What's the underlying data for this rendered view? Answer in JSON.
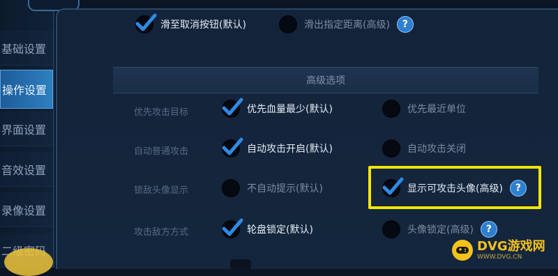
{
  "sidebar": {
    "items": [
      {
        "label": "基础设置",
        "active": false
      },
      {
        "label": "操作设置",
        "active": true
      },
      {
        "label": "界面设置",
        "active": false
      },
      {
        "label": "音效设置",
        "active": false
      },
      {
        "label": "录像设置",
        "active": false
      },
      {
        "label": "二级密码",
        "active": false
      }
    ]
  },
  "top_row": {
    "opt1": {
      "label": "滑至取消按钮(默认)",
      "checked": true
    },
    "opt2": {
      "label": "滑出指定距离(高级)",
      "checked": false,
      "help": "?"
    }
  },
  "advanced": {
    "header": "高级选项",
    "rows": [
      {
        "label": "优先攻击目标",
        "left": {
          "label": "优先血量最少(默认)",
          "checked": true
        },
        "right": {
          "label": "优先最近单位",
          "checked": false
        }
      },
      {
        "label": "自动普通攻击",
        "left": {
          "label": "自动攻击开启(默认)",
          "checked": true
        },
        "right": {
          "label": "自动攻击关闭",
          "checked": false
        }
      },
      {
        "label": "锁敌头像显示",
        "left": {
          "label": "不自动提示(默认)",
          "checked": false
        },
        "right": {
          "label": "显示可攻击头像(高级)",
          "checked": true,
          "help": "?"
        }
      },
      {
        "label": "攻击敌方方式",
        "left": {
          "label": "轮盘锁定(默认)",
          "checked": true
        },
        "right": {
          "label": "头像锁定(高级)",
          "checked": false,
          "help": "?"
        }
      }
    ]
  },
  "logo": {
    "main": "DVG游戏网",
    "sub": "WWW.DVG.CN"
  },
  "colors": {
    "accent": "#2e7fbf",
    "highlight": "#f3e600",
    "check": "#2f8ae6"
  }
}
